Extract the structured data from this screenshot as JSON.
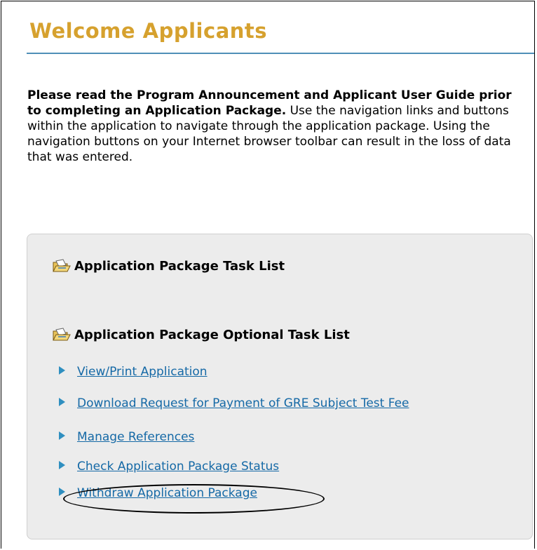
{
  "header": {
    "title": "Welcome Applicants"
  },
  "intro": {
    "bold_text": "Please read the Program Announcement and Applicant User Guide prior to completing an Application Package.",
    "body_text": " Use the navigation links and buttons within the application to navigate through the application package. Using the navigation buttons on your Internet browser toolbar can result in the loss of data that was entered."
  },
  "tasks": {
    "task_list_label": "Application Package Task List",
    "optional_task_list_label": "Application Package Optional Task List",
    "links": [
      {
        "label": "View/Print Application"
      },
      {
        "label": "Download Request for Payment of GRE Subject Test Fee"
      },
      {
        "label": "Manage References"
      },
      {
        "label": "Check Application Package Status"
      },
      {
        "label": "Withdraw Application Package"
      }
    ]
  },
  "icons": {
    "folder": "open-folder-icon",
    "bullet": "triangle-bullet-icon"
  },
  "colors": {
    "title": "#d6a12e",
    "rule": "#4f8fb7",
    "link": "#1569a6",
    "panel_bg": "#ececec"
  }
}
